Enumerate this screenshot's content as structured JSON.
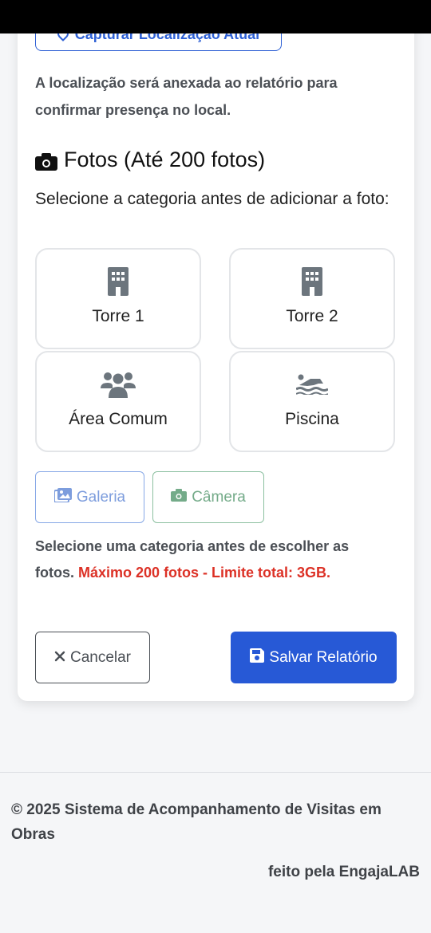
{
  "location": {
    "capture_label": "Capturar Localização Atual",
    "note": "A localização será anexada ao relatório para confirmar presença no local."
  },
  "photos": {
    "title": "Fotos (Até 200 fotos)",
    "subtitle": "Selecione a categoria antes de adicionar a foto:",
    "categories": [
      {
        "label": "Torre 1",
        "icon": "building-icon"
      },
      {
        "label": "Torre 2",
        "icon": "building-icon"
      },
      {
        "label": "Área Comum",
        "icon": "users-icon"
      },
      {
        "label": "Piscina",
        "icon": "swimmer-icon"
      }
    ],
    "gallery_label": "Galeria",
    "camera_label": "Câmera",
    "note_prefix": "Selecione uma categoria antes de escolher as fotos.",
    "note_warning": "Máximo 200 fotos - Limite total: 3GB."
  },
  "actions": {
    "cancel_label": "Cancelar",
    "save_label": "Salvar Relatório"
  },
  "footer": {
    "copyright": "© 2025 Sistema de Acompanhamento de Visitas em Obras",
    "made_by": "feito pela EngajaLAB"
  },
  "colors": {
    "primary": "#2759d6",
    "danger": "#dc3126",
    "gallery": "#7d9ddd",
    "camera": "#74ab89",
    "icon_gray": "#6c757d"
  }
}
